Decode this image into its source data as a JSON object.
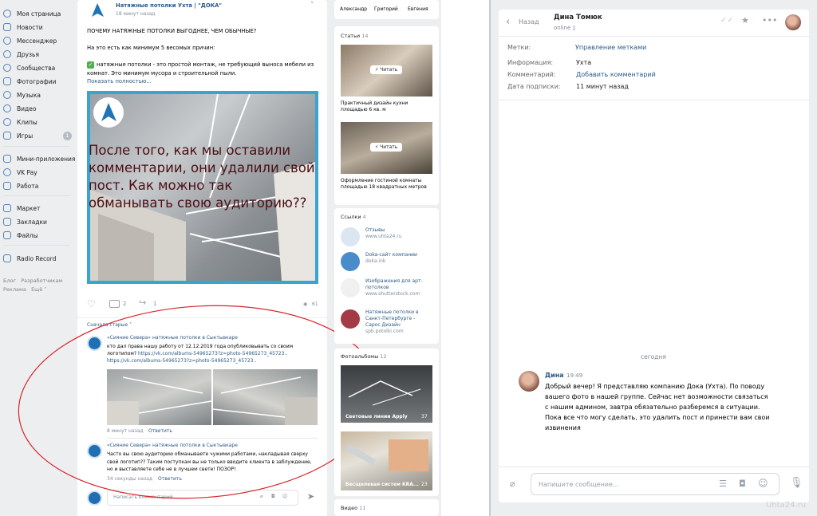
{
  "sidebar": {
    "items": [
      {
        "label": "Моя страница",
        "icon": "home-icon"
      },
      {
        "label": "Новости",
        "icon": "news-icon"
      },
      {
        "label": "Мессенджер",
        "icon": "messenger-icon"
      },
      {
        "label": "Друзья",
        "icon": "friends-icon"
      },
      {
        "label": "Сообщества",
        "icon": "communities-icon"
      },
      {
        "label": "Фотографии",
        "icon": "photos-icon"
      },
      {
        "label": "Музыка",
        "icon": "music-icon"
      },
      {
        "label": "Видео",
        "icon": "video-icon"
      },
      {
        "label": "Клипы",
        "icon": "clips-icon"
      },
      {
        "label": "Игры",
        "icon": "games-icon",
        "badge": "1"
      },
      {
        "label": "Мини-приложения",
        "icon": "apps-icon"
      },
      {
        "label": "VK Pay",
        "icon": "vkpay-icon"
      },
      {
        "label": "Работа",
        "icon": "work-icon"
      },
      {
        "label": "Маркет",
        "icon": "market-icon"
      },
      {
        "label": "Закладки",
        "icon": "bookmarks-icon"
      },
      {
        "label": "Файлы",
        "icon": "files-icon"
      },
      {
        "label": "Radio Record",
        "icon": "radio-icon"
      }
    ],
    "footer": {
      "blog": "Блог",
      "devs": "Разработчикам",
      "ads": "Реклама",
      "more": "Ещё"
    }
  },
  "post": {
    "author": "Натяжные потолки Ухта | \"ДОКА\"",
    "time": "18 минут назад",
    "headline": "ПОЧЕМУ НАТЯЖНЫЕ ПОТОЛКИ ВЫГОДНЕЕ, ЧЕМ ОБЫЧНЫЕ?",
    "intro": "На это есть как минимум 5 весомых причин:",
    "point": "натяжные потолки - это простой монтаж, не требующий выноса мебели из комнат. Это минимум мусора и строительной пыли.",
    "show_more": "Показать полностью...",
    "overlay_text": "После того, как мы оставили комментарии, они удалили свой пост. Как можно так обманывать свою аудиторию??",
    "comments_count": "2",
    "shares_count": "1",
    "views_count": "61"
  },
  "comments": {
    "sort": "Сначала старые",
    "items": [
      {
        "author": "«Сияние Севера» натяжные потолки в Сыктывкаре",
        "text": "кто дал права нашу работу от 12.12.2019 года опубликовывать со своим логотипом? ",
        "link1": "https://vk.com/albums-54965273?z=photo-54965273_45723..",
        "link2": "https://vk.com/albums-54965273?z=photo-54965273_45723..",
        "time": "8 минут назад",
        "reply": "Ответить"
      },
      {
        "author": "«Сияние Севера» натяжные потолки в Сыктывкаре",
        "text": "Часто вы свою аудиторию обманываете чужими работами, накладывая сверху свой логотип?? Таким поступкам вы не только вводите клиента в заблуждение, но и выставляете себе не в лучшем свете! ПОЗОР!",
        "time": "34 секунды назад",
        "reply": "Ответить"
      }
    ],
    "input_placeholder": "Написать комментарий..."
  },
  "right_col": {
    "friends": [
      "Александр",
      "Григорий",
      "Евгения"
    ],
    "articles_title": "Статьи",
    "articles_count": "14",
    "read_label": "Читать",
    "articles": [
      {
        "title": "Практичный дизайн кухни площадью 6 кв. м"
      },
      {
        "title": "Оформление гостиной комнаты площадью 18 квадратных метров"
      }
    ],
    "links_title": "Ссылки",
    "links_count": "4",
    "links": [
      {
        "title": "Отзывы",
        "url": "www.uhta24.ru"
      },
      {
        "title": "Doka-сайт компании",
        "url": "doka.ink"
      },
      {
        "title": "Изображения для арт-потолков",
        "url": "www.shutterstock.com"
      },
      {
        "title": "Натяжные потолки в Санкт-Петербурге - Сарос Дизайн",
        "url": "spb.potolki.com"
      }
    ],
    "albums_title": "Фотоальбомы",
    "albums_count": "12",
    "albums": [
      {
        "title": "Световые линии Apply",
        "count": "37"
      },
      {
        "title": "Бесщелевая систем KRA...",
        "count": "23"
      }
    ],
    "video_title": "Видео",
    "video_count": "11"
  },
  "chat": {
    "back": "Назад",
    "name": "Дина Томюк",
    "status": "online",
    "labels": [
      {
        "key": "Метки:",
        "value": "Управление метками",
        "link": true
      },
      {
        "key": "Информация:",
        "value": "Ухта",
        "link": false
      },
      {
        "key": "Комментарий:",
        "value": "Добавить комментарий",
        "link": true
      },
      {
        "key": "Дата подписки:",
        "value": "11 минут назад",
        "link": false
      }
    ],
    "date_divider": "сегодня",
    "message": {
      "author": "Дина",
      "time": "19:49",
      "text": "Добрый вечер! Я представляю компанию Дока (Ухта). По поводу вашего фото в нашей группе. Сейчас нет возможности связаться с нашим админом, завтра обязательно разберемся в ситуации. Пока все что могу сделать, это удалить пост и принести вам свои извинения"
    },
    "composer_placeholder": "Напишите сообщение...",
    "watermark": "Uhta24.ru"
  },
  "colors": {
    "accent": "#2a5885",
    "vk_blue": "#5181b8",
    "annotation": "#d9232a",
    "bg": "#edeef0"
  }
}
